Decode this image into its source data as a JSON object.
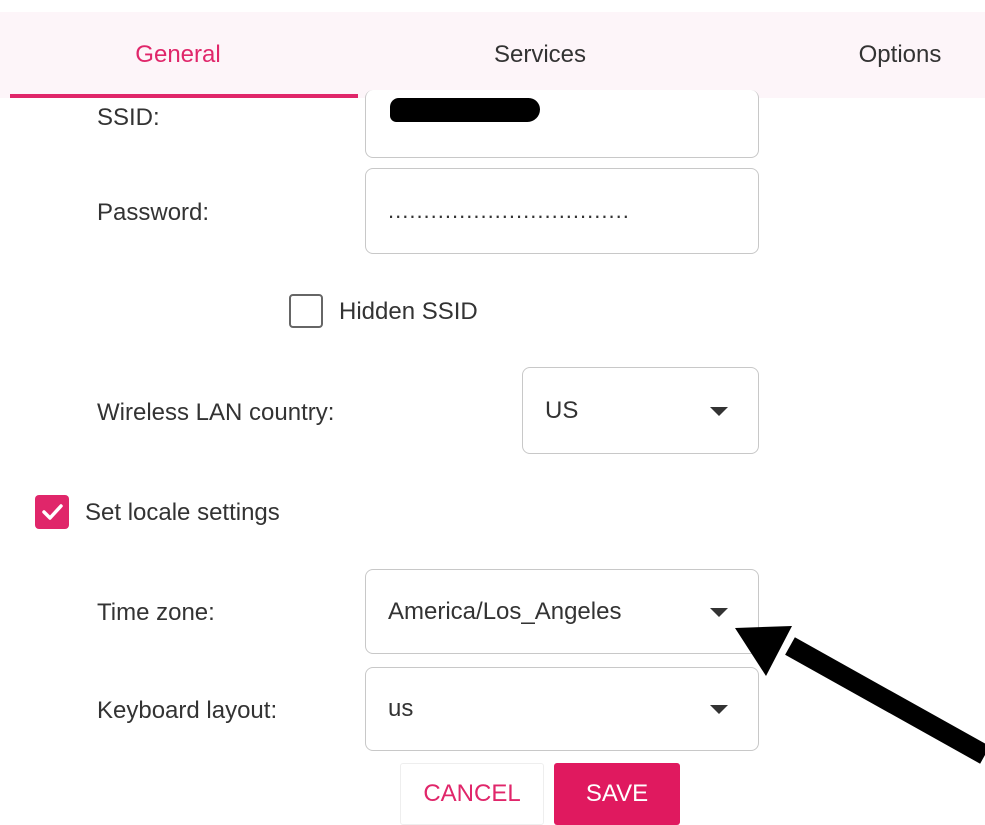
{
  "tabs": [
    {
      "label": "General",
      "active": true
    },
    {
      "label": "Services",
      "active": false
    },
    {
      "label": "Options",
      "active": false
    }
  ],
  "wifi": {
    "ssid_label": "SSID:",
    "ssid_value": "[redacted]",
    "password_label": "Password:",
    "password_mask": "..................................",
    "hidden_ssid_label": "Hidden SSID",
    "hidden_ssid_checked": false,
    "country_label": "Wireless LAN country:",
    "country_value": "US"
  },
  "locale": {
    "set_locale_label": "Set locale settings",
    "set_locale_checked": true,
    "timezone_label": "Time zone:",
    "timezone_value": "America/Los_Angeles",
    "keyboard_label": "Keyboard layout:",
    "keyboard_value": "us"
  },
  "actions": {
    "cancel_label": "CANCEL",
    "save_label": "SAVE"
  },
  "colors": {
    "accent": "#e0266a",
    "save_bg": "#e0195f",
    "tabbar_bg": "#fdf5f9",
    "text": "#333333",
    "border": "#c8c8c8"
  },
  "icons": {
    "dropdown": "caret-down-icon",
    "checkmark": "checkmark-icon",
    "annotation": "arrow-icon"
  }
}
